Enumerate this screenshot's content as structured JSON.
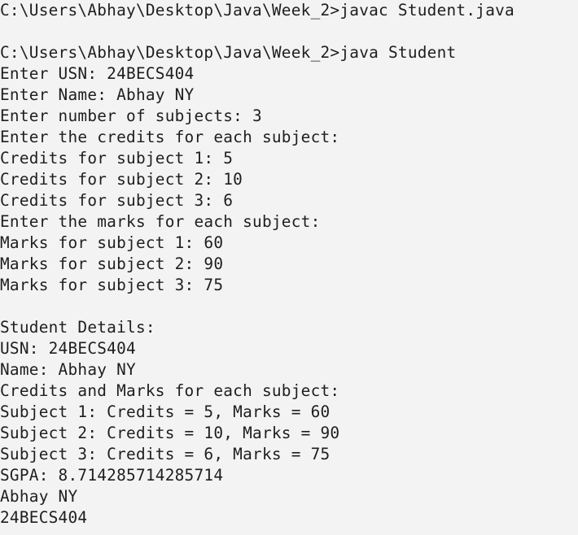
{
  "terminal": {
    "lines": [
      "C:\\Users\\Abhay\\Desktop\\Java\\Week_2>javac Student.java",
      "",
      "C:\\Users\\Abhay\\Desktop\\Java\\Week_2>java Student",
      "Enter USN: 24BECS404",
      "Enter Name: Abhay NY",
      "Enter number of subjects: 3",
      "Enter the credits for each subject:",
      "Credits for subject 1: 5",
      "Credits for subject 2: 10",
      "Credits for subject 3: 6",
      "Enter the marks for each subject:",
      "Marks for subject 1: 60",
      "Marks for subject 2: 90",
      "Marks for subject 3: 75",
      "",
      "Student Details:",
      "USN: 24BECS404",
      "Name: Abhay NY",
      "Credits and Marks for each subject:",
      "Subject 1: Credits = 5, Marks = 60",
      "Subject 2: Credits = 10, Marks = 90",
      "Subject 3: Credits = 6, Marks = 75",
      "SGPA: 8.714285714285714",
      "Abhay NY",
      "24BECS404"
    ]
  }
}
